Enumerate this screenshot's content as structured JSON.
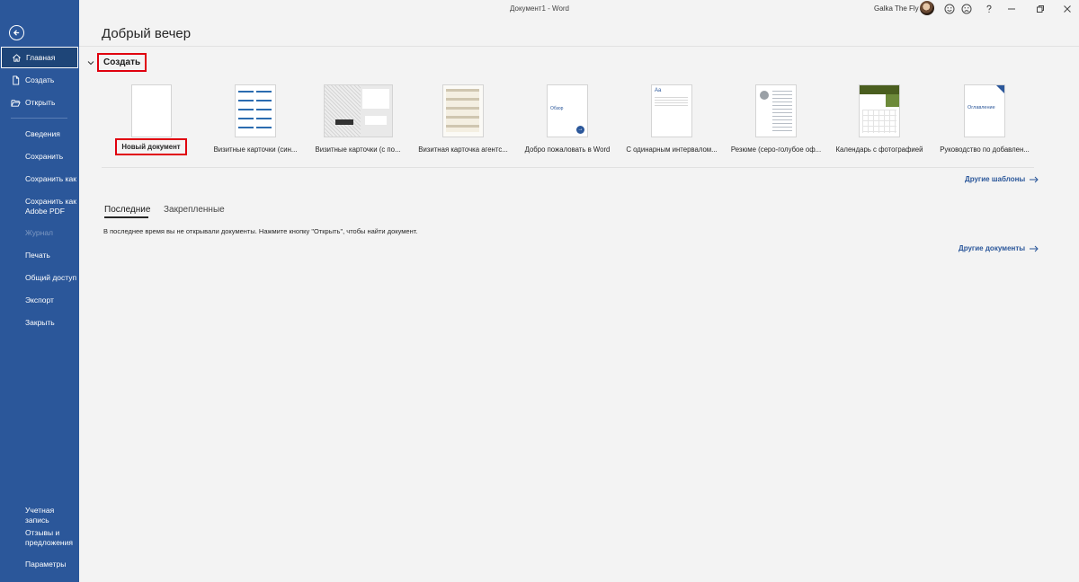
{
  "window": {
    "title": "Документ1 - Word",
    "user_name": "Galka The Fly"
  },
  "sidebar": {
    "home": "Главная",
    "new": "Создать",
    "open": "Открыть",
    "info": "Сведения",
    "save": "Сохранить",
    "save_as": "Сохранить как",
    "save_pdf_line1": "Сохранить как",
    "save_pdf_line2": "Adobe PDF",
    "history": "Журнал",
    "print": "Печать",
    "share": "Общий доступ",
    "export": "Экспорт",
    "close": "Закрыть",
    "account": "Учетная запись",
    "feedback_line1": "Отзывы и",
    "feedback_line2": "предложения",
    "options": "Параметры"
  },
  "main": {
    "greeting": "Добрый вечер",
    "create_section": "Создать",
    "templates": [
      {
        "label": "Новый документ"
      },
      {
        "label": "Визитные карточки (син..."
      },
      {
        "label": "Визитные карточки (с по..."
      },
      {
        "label": "Визитная карточка агентс..."
      },
      {
        "label": "Добро пожаловать в Word",
        "thumb_text": "Обзор"
      },
      {
        "label": "С одинарным интервалом...",
        "thumb_text": "Aa"
      },
      {
        "label": "Резюме (серо-голубое оф..."
      },
      {
        "label": "Календарь с фотографией"
      },
      {
        "label": "Руководство по добавлен...",
        "thumb_text": "Оглавление"
      }
    ],
    "more_templates": "Другие шаблоны",
    "tabs": [
      "Последние",
      "Закрепленные"
    ],
    "empty_message": "В последнее время вы не открывали документы. Нажмите кнопку \"Открыть\", чтобы найти документ.",
    "more_documents": "Другие документы"
  },
  "colors": {
    "sidebar": "#2b579a",
    "sidebar_selected": "#1e4578",
    "highlight_box": "#e0000e",
    "link": "#2b579a"
  }
}
